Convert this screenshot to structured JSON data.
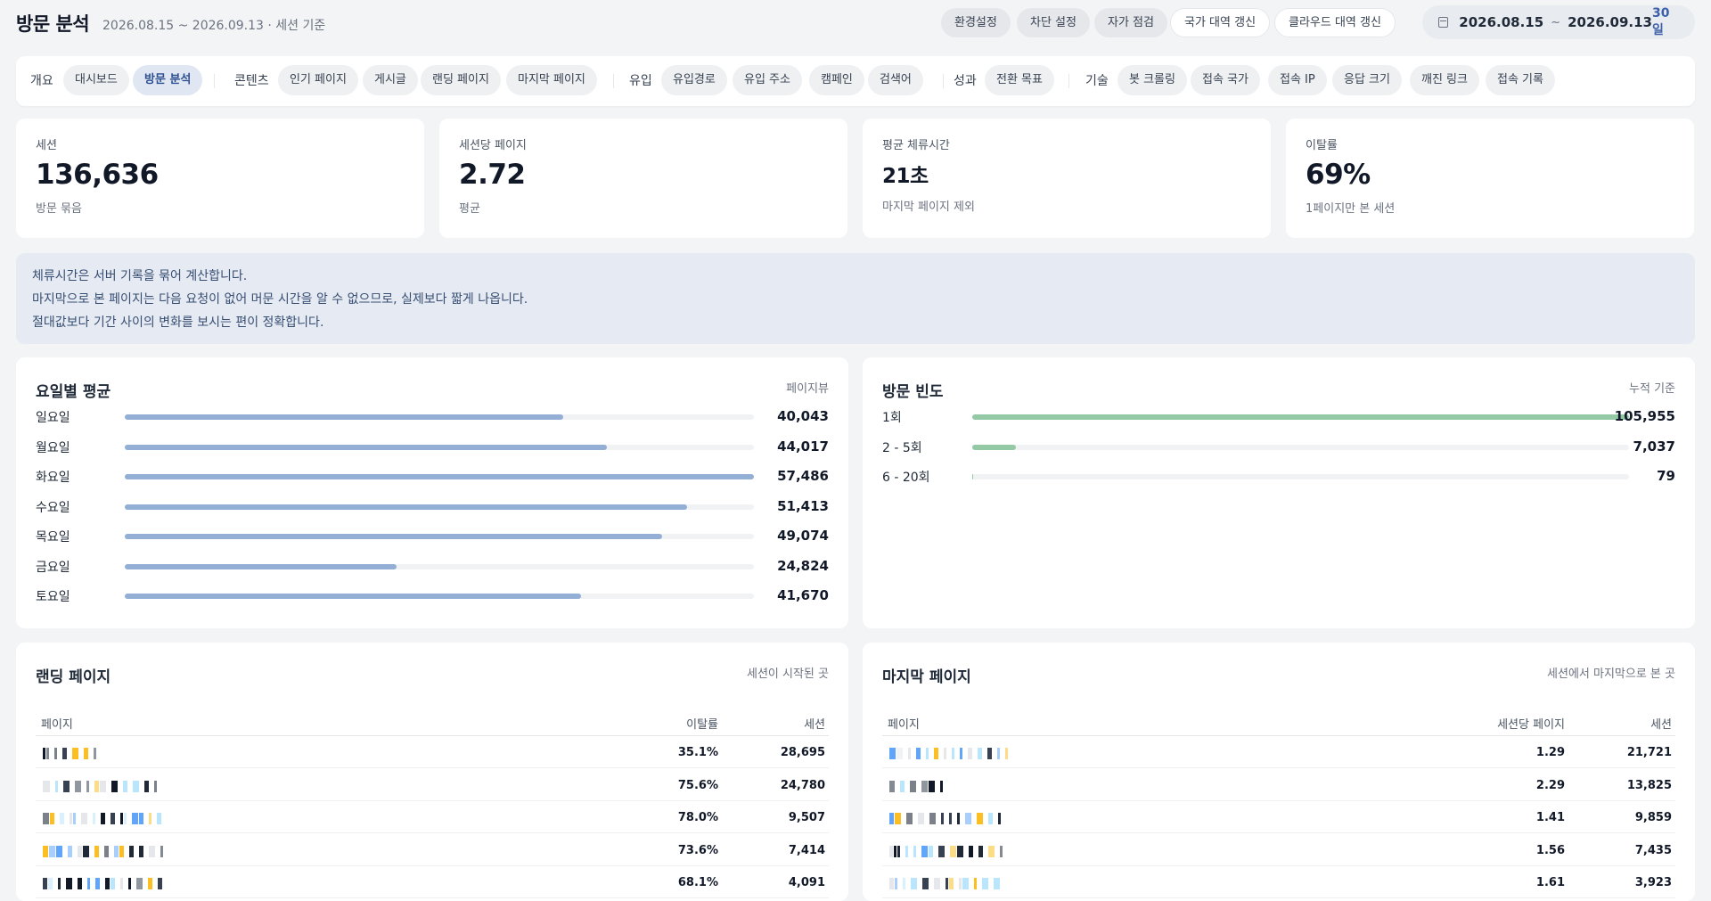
{
  "header": {
    "title": "방문 분석",
    "subtitle": "2026.08.15 ~ 2026.09.13 · 세션 기준",
    "buttons": [
      "환경설정",
      "차단 설정",
      "자가 점검",
      "국가 대역 갱신",
      "클라우드 대역 갱신"
    ],
    "date_from": "2026.08.15",
    "date_sep": "~",
    "date_to": "2026.09.13",
    "days": "30일",
    "calendar_icon": "calendar-icon"
  },
  "nav": {
    "g1_label": "개요",
    "g1_items": [
      "대시보드",
      "방문 분석"
    ],
    "g2_label": "콘텐츠",
    "g2_items": [
      "인기 페이지",
      "게시글",
      "랜딩 페이지",
      "마지막 페이지"
    ],
    "g3_label": "유입",
    "g3_items": [
      "유입경로",
      "유입 주소",
      "캠페인",
      "검색어"
    ],
    "g4_label": "성과",
    "g4_items": [
      "전환 목표"
    ],
    "g5_label": "기술",
    "g5_items": [
      "봇 크롤링",
      "접속 국가",
      "접속 IP",
      "응답 크기",
      "깨진 링크",
      "접속 기록"
    ],
    "active": "방문 분석"
  },
  "stats": [
    {
      "label": "세션",
      "value": "136,636",
      "sub": "방문 묶음"
    },
    {
      "label": "세션당 페이지",
      "value": "2.72",
      "sub": "평균"
    },
    {
      "label": "평균 체류시간",
      "value": "21초",
      "sub": "마지막 페이지 제외"
    },
    {
      "label": "이탈률",
      "value": "69%",
      "sub": "1페이지만 본 세션"
    }
  ],
  "notice": [
    "체류시간은 서버 기록을 묶어 계산합니다.",
    "마지막으로 본 페이지는 다음 요청이 없어 머문 시간을 알 수 없으므로, 실제보다 짧게 나옵니다.",
    "절대값보다 기간 사이의 변화를 보시는 편이 정확합니다."
  ],
  "weekday": {
    "title": "요일별 평균",
    "note": "페이지뷰",
    "color": "#93afd6",
    "max": 57486,
    "rows": [
      {
        "label": "일요일",
        "value": 40043,
        "display": "40,043"
      },
      {
        "label": "월요일",
        "value": 44017,
        "display": "44,017"
      },
      {
        "label": "화요일",
        "value": 57486,
        "display": "57,486"
      },
      {
        "label": "수요일",
        "value": 51413,
        "display": "51,413"
      },
      {
        "label": "목요일",
        "value": 49074,
        "display": "49,074"
      },
      {
        "label": "금요일",
        "value": 24824,
        "display": "24,824"
      },
      {
        "label": "토요일",
        "value": 41670,
        "display": "41,670"
      }
    ]
  },
  "frequency": {
    "title": "방문 빈도",
    "note": "누적 기준",
    "color": "#93c9a4",
    "max": 105955,
    "rows": [
      {
        "label": "1회",
        "value": 105955,
        "display": "105,955"
      },
      {
        "label": "2 - 5회",
        "value": 7037,
        "display": "7,037"
      },
      {
        "label": "6 - 20회",
        "value": 79,
        "display": "79"
      }
    ]
  },
  "landing": {
    "title": "랜딩 페이지",
    "note": "세션이 시작된 곳",
    "headers": [
      "페이지",
      "이탈률",
      "세션"
    ],
    "rows": [
      {
        "bounce": "35.1%",
        "sessions": "28,695"
      },
      {
        "bounce": "75.6%",
        "sessions": "24,780"
      },
      {
        "bounce": "78.0%",
        "sessions": "9,507"
      },
      {
        "bounce": "73.6%",
        "sessions": "7,414"
      },
      {
        "bounce": "68.1%",
        "sessions": "4,091"
      }
    ]
  },
  "exit": {
    "title": "마지막 페이지",
    "note": "세션에서 마지막으로 본 곳",
    "headers": [
      "페이지",
      "세션당 페이지",
      "세션"
    ],
    "rows": [
      {
        "ppv": "1.29",
        "sessions": "21,721"
      },
      {
        "ppv": "2.29",
        "sessions": "13,825"
      },
      {
        "ppv": "1.41",
        "sessions": "9,859"
      },
      {
        "ppv": "1.56",
        "sessions": "7,435"
      },
      {
        "ppv": "1.61",
        "sessions": "3,923"
      }
    ]
  }
}
